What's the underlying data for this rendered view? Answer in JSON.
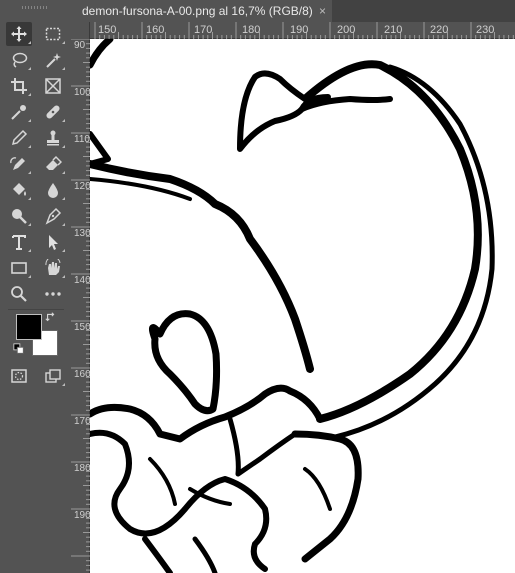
{
  "document": {
    "tab_title": "demon-fursona-A-00.png al 16,7% (RGB/8)",
    "close_symbol": "×"
  },
  "rulers": {
    "horizontal": [
      "150",
      "160",
      "170",
      "180",
      "190",
      "200",
      "210",
      "220",
      "230"
    ],
    "vertical": [
      "90",
      "100",
      "110",
      "120",
      "130",
      "140",
      "150",
      "160",
      "170",
      "180",
      "190"
    ]
  },
  "colors": {
    "ui_background": "#535353",
    "foreground": "#000000",
    "background": "#ffffff"
  },
  "toolbar": {
    "tools": [
      {
        "name": "move-tool-icon",
        "glyph": "✥"
      },
      {
        "name": "marquee-tool-icon",
        "glyph": "⬚"
      },
      {
        "name": "lasso-tool-icon",
        "glyph": "◯"
      },
      {
        "name": "magic-wand-tool-icon",
        "glyph": "✦"
      },
      {
        "name": "crop-tool-icon",
        "glyph": "⌗"
      },
      {
        "name": "frame-tool-icon",
        "glyph": "⊠"
      },
      {
        "name": "eyedropper-tool-icon",
        "glyph": "⟋"
      },
      {
        "name": "healing-brush-tool-icon",
        "glyph": "✚"
      },
      {
        "name": "brush-tool-icon",
        "glyph": "✎"
      },
      {
        "name": "stamp-tool-icon",
        "glyph": "⊥"
      },
      {
        "name": "history-brush-tool-icon",
        "glyph": "✎"
      },
      {
        "name": "eraser-tool-icon",
        "glyph": "◧"
      },
      {
        "name": "paint-bucket-tool-icon",
        "glyph": "◈"
      },
      {
        "name": "blur-tool-icon",
        "glyph": "●"
      },
      {
        "name": "dodge-tool-icon",
        "glyph": "⚲"
      },
      {
        "name": "pen-tool-icon",
        "glyph": "✒"
      },
      {
        "name": "type-tool-icon",
        "glyph": "T"
      },
      {
        "name": "path-selection-tool-icon",
        "glyph": "➤"
      },
      {
        "name": "rectangle-tool-icon",
        "glyph": "▭"
      },
      {
        "name": "hand-tool-icon",
        "glyph": "✋"
      },
      {
        "name": "zoom-tool-icon",
        "glyph": "⚲"
      },
      {
        "name": "more-tools-icon",
        "glyph": "•••"
      }
    ]
  }
}
